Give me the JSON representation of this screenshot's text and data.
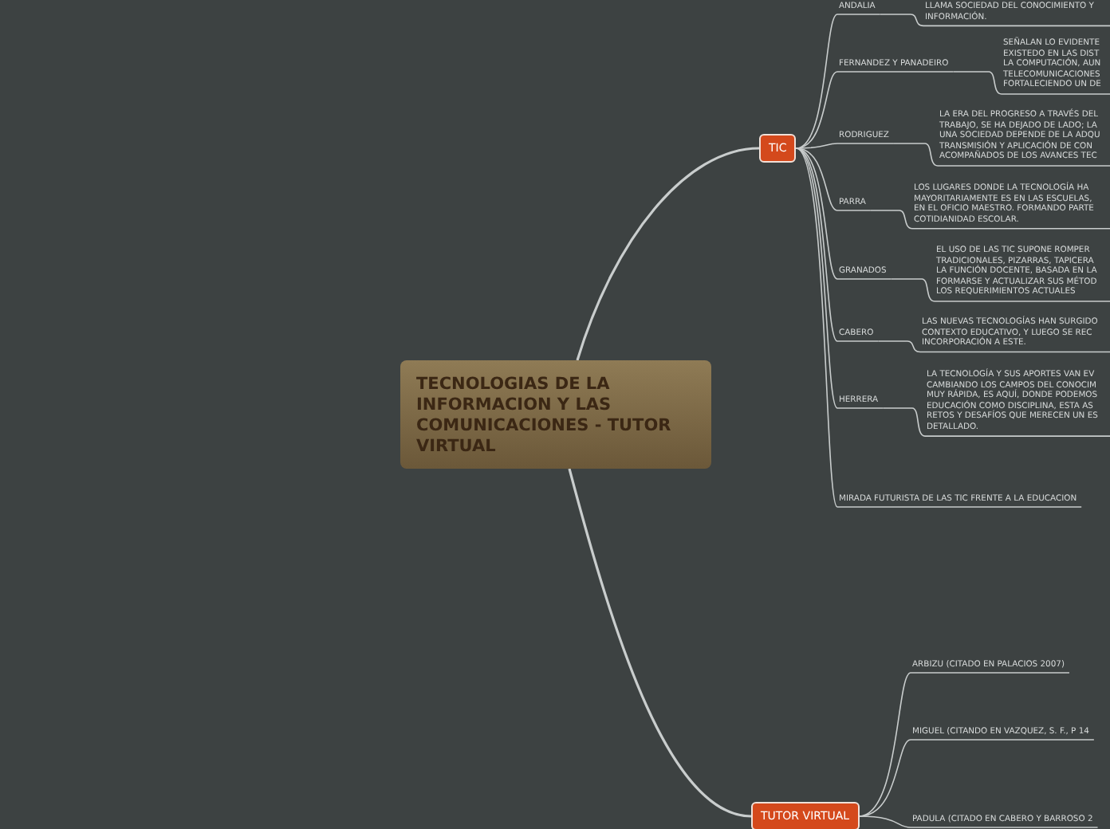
{
  "central_topic": "TECNOLOGIAS DE LA INFORMACION Y LAS COMUNICACIONES - TUTOR VIRTUAL",
  "branches": [
    {
      "label": "TIC",
      "children": [
        {
          "label": "ANDALIA",
          "note_lines": [
            "LLAMA SOCIEDAD DEL CONOCIMIENTO Y",
            "INFORMACIÓN."
          ]
        },
        {
          "label": "FERNANDEZ Y PANADEIRO",
          "note_lines": [
            "SEÑALAN LO EVIDENTE",
            "EXISTEDO EN LAS DIST",
            "LA COMPUTACIÓN, AUN",
            "TELECOMUNICACIONES",
            "FORTALECIENDO UN DE"
          ]
        },
        {
          "label": "RODRIGUEZ",
          "note_lines": [
            "LA ERA DEL PROGRESO A TRAVÉS DEL",
            "TRABAJO, SE HA DEJADO DE LADO; LA",
            "UNA SOCIEDAD DEPENDE DE LA ADQU",
            "TRANSMISIÓN Y APLICACIÓN DE CON",
            "ACOMPAÑADOS DE LOS AVANCES TEC"
          ]
        },
        {
          "label": "PARRA",
          "note_lines": [
            "LOS LUGARES DONDE LA TECNOLOGÍA HA",
            "MAYORITARIAMENTE ES EN LAS ESCUELAS,",
            "EN EL OFICIO MAESTRO. FORMANDO PARTE",
            "COTIDIANIDAD ESCOLAR."
          ]
        },
        {
          "label": "GRANADOS",
          "note_lines": [
            "EL USO DE LAS TIC SUPONE ROMPER",
            "TRADICIONALES, PIZARRAS, TAPICERA",
            "LA FUNCIÓN DOCENTE, BASADA EN LA",
            "FORMARSE Y ACTUALIZAR SUS MÉTOD",
            "LOS REQUERIMIENTOS ACTUALES"
          ]
        },
        {
          "label": "CABERO",
          "note_lines": [
            "LAS NUEVAS TECNOLOGÍAS HAN SURGIDO",
            "CONTEXTO EDUCATIVO, Y LUEGO SE REC",
            "INCORPORACIÓN A ESTE."
          ]
        },
        {
          "label": "HERRERA",
          "note_lines": [
            "LA TECNOLOGÍA Y SUS APORTES VAN EV",
            "CAMBIANDO LOS CAMPOS DEL CONOCIM",
            "MUY RÁPIDA, ES AQUÍ, DONDE PODEMOS",
            "EDUCACIÓN COMO DISCIPLINA, ESTA AS",
            "RETOS Y DESAFÍOS QUE MERECEN UN ES",
            "DETALLADO."
          ]
        },
        {
          "label": "MIRADA FUTURISTA DE LAS TIC FRENTE A LA EDUCACION"
        }
      ]
    },
    {
      "label": "TUTOR VIRTUAL",
      "children": [
        {
          "label": "ARBIZU (CITADO EN PALACIOS 2007)"
        },
        {
          "label": "MIGUEL (CITANDO EN VAZQUEZ, S. F., P 14"
        },
        {
          "label": "PADULA (CITADO EN CABERO Y BARROSO 2"
        }
      ]
    }
  ]
}
